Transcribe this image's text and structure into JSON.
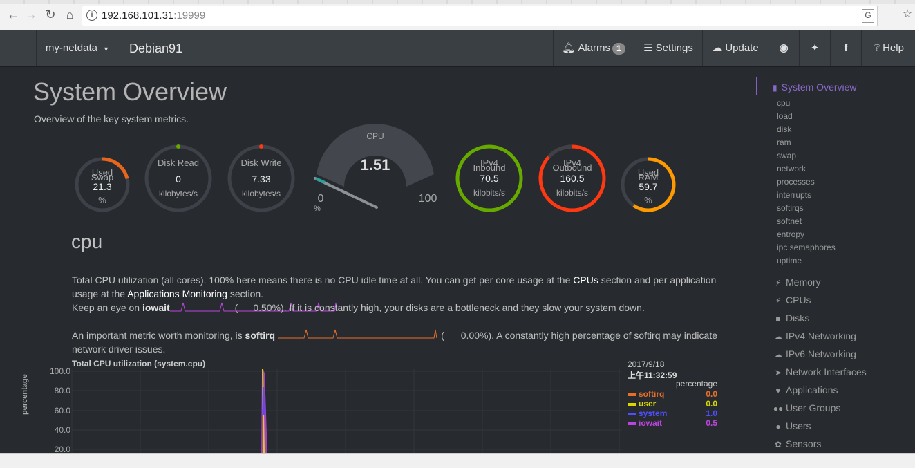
{
  "browser": {
    "url_host": "192.168.101.31",
    "url_port": ":19999",
    "back_icon": "back-arrow-icon",
    "forward_icon": "forward-arrow-icon",
    "reload_icon": "reload-icon",
    "home_icon": "home-icon",
    "translate_icon": "translate-icon",
    "bookmark_icon": "star-icon"
  },
  "navbar": {
    "brand": "my-netdata",
    "host": "Debian91",
    "alarms_label": "Alarms",
    "alarms_count": "1",
    "settings_label": "Settings",
    "update_label": "Update",
    "help_label": "Help"
  },
  "main": {
    "title": "System Overview",
    "subtitle": "Overview of the key system metrics."
  },
  "gauges": {
    "swap": {
      "label1": "Used",
      "label2": "Swap",
      "value": "21.3",
      "unit": "%",
      "fraction": 0.213
    },
    "disk_read": {
      "label": "Disk Read",
      "value": "0",
      "unit": "kilobytes/s"
    },
    "disk_write": {
      "label": "Disk Write",
      "value": "7.33",
      "unit": "kilobytes/s"
    },
    "cpu": {
      "label": "CPU",
      "value": "1.51",
      "min": "0",
      "max": "100",
      "unit": "%",
      "fraction": 0.0151
    },
    "ipv4_in": {
      "label1": "IPv4",
      "label2": "Inbound",
      "value": "70.5",
      "unit": "kilobits/s",
      "color": "#66aa00"
    },
    "ipv4_out": {
      "label1": "IPv4",
      "label2": "Outbound",
      "value": "160.5",
      "unit": "kilobits/s",
      "color": "#fe3912"
    },
    "ram": {
      "label1": "Used",
      "label2": "RAM",
      "value": "59.7",
      "unit": "%",
      "fraction": 0.597,
      "color": "#ff9900"
    }
  },
  "cpu_section": {
    "heading": "cpu",
    "p1_a": "Total CPU utilization (all cores). 100% here means there is no CPU idle time at all. You can get per core usage at the ",
    "p1_link1": "CPUs",
    "p1_b": " section and per application usage at the ",
    "p1_link2": "Applications Monitoring",
    "p1_c": " section.",
    "p2_a": "Keep an eye on ",
    "p2_b": "iowait",
    "p2_val": "0.50%",
    "p2_c": "). If it is constantly high, your disks are a bottleneck and they slow your system down.",
    "p3_a": "An important metric worth monitoring, is ",
    "p3_b": "softirq",
    "p3_val": "0.00%",
    "p3_c": "). A constantly high percentage of softirq may indicate network driver issues."
  },
  "chart": {
    "title": "Total CPU utilization (system.cpu)",
    "date": "2017/9/18",
    "time": "上午11:32:59",
    "units": "percentage",
    "ylabel": "percentage",
    "ticks": [
      "100.0",
      "80.0",
      "60.0",
      "40.0",
      "20.0"
    ],
    "legend": [
      {
        "name": "softirq",
        "value": "0.0",
        "color": "#e86f2a"
      },
      {
        "name": "user",
        "value": "0.0",
        "color": "#d8d800"
      },
      {
        "name": "system",
        "value": "1.0",
        "color": "#4f4fff"
      },
      {
        "name": "iowait",
        "value": "0.5",
        "color": "#bb44dd"
      }
    ]
  },
  "sidebar": {
    "active": "System Overview",
    "sub": [
      "cpu",
      "load",
      "disk",
      "ram",
      "swap",
      "network",
      "processes",
      "interrupts",
      "softirqs",
      "softnet",
      "entropy",
      "ipc semaphores",
      "uptime"
    ],
    "sections": [
      {
        "label": "Memory",
        "icon": "bolt-icon"
      },
      {
        "label": "CPUs",
        "icon": "bolt-icon"
      },
      {
        "label": "Disks",
        "icon": "folder-icon"
      },
      {
        "label": "IPv4 Networking",
        "icon": "cloud-icon"
      },
      {
        "label": "IPv6 Networking",
        "icon": "cloud-icon"
      },
      {
        "label": "Network Interfaces",
        "icon": "share-icon"
      },
      {
        "label": "Applications",
        "icon": "heartbeat-icon"
      },
      {
        "label": "User Groups",
        "icon": "users-icon"
      },
      {
        "label": "Users",
        "icon": "user-icon"
      },
      {
        "label": "Sensors",
        "icon": "leaf-icon"
      }
    ]
  }
}
